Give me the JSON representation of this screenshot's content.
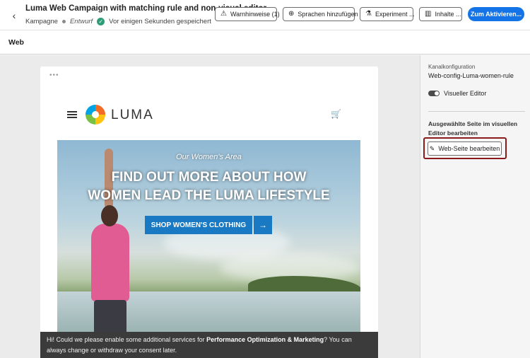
{
  "header": {
    "back_icon": "chevron-left-icon",
    "title": "Luma Web Campaign with matching rule and non-visual editor",
    "type_label": "Kampagne",
    "status": "Entwurf",
    "saved_text": "Vor einigen Sekunden gespeichert",
    "buttons": {
      "warnings": "Warnhinweise (1)",
      "languages": "Sprachen hinzufügen",
      "experiment": "Experiment ...",
      "content": "Inhalte ...",
      "activate": "Zum Aktivieren..."
    },
    "accent_color": "#1473e6"
  },
  "subheader": {
    "title": "Web"
  },
  "preview": {
    "dots": "•••",
    "brand": "LUMA",
    "hero_kicker": "Our Women's Area",
    "hero_heading_1": "FIND OUT MORE ABOUT HOW",
    "hero_heading_2": "WOMEN LEAD THE LUMA LIFESTYLE",
    "cta_label": "SHOP WOMEN'S CLOTHING",
    "cta_arrow": "→",
    "consent_pre": "Hi! Could we please enable some additional services for ",
    "consent_bold": "Performance Optimization & Marketing",
    "consent_post": "? You can always change or withdraw your consent later."
  },
  "panel": {
    "channel_label": "Kanalkonfiguration",
    "channel_value": "Web-config-Luma-women-rule",
    "visual_editor_label": "Visueller Editor",
    "visual_editor_on": true,
    "section_title": "Ausgewählte Seite im visuellen Editor bearbeiten",
    "edit_button": "Web-Seite bearbeiten"
  }
}
